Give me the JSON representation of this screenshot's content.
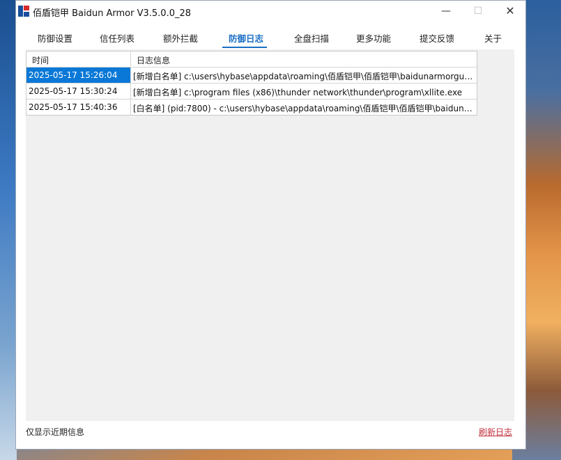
{
  "window": {
    "title": "佰盾铠甲 Baidun Armor  V3.5.0.0_28",
    "minimize": "—",
    "maximize": "☐",
    "close": "✕",
    "brand_colors": {
      "red": "#d62b2b",
      "blue": "#1a4f9e"
    }
  },
  "tabs": [
    {
      "label": "防御设置",
      "active": false
    },
    {
      "label": "信任列表",
      "active": false
    },
    {
      "label": "额外拦截",
      "active": false
    },
    {
      "label": "防御日志",
      "active": true
    },
    {
      "label": "全盘扫描",
      "active": false
    },
    {
      "label": "更多功能",
      "active": false
    },
    {
      "label": "提交反馈",
      "active": false
    },
    {
      "label": "关于",
      "active": false
    }
  ],
  "log_table": {
    "headers": {
      "time": "时间",
      "message": "日志信息"
    },
    "rows": [
      {
        "time": "2025-05-17 15:26:04",
        "message": "[新增白名单] c:\\users\\hybase\\appdata\\roaming\\佰盾铠甲\\佰盾铠甲\\baidunarmorgui...",
        "selected": true
      },
      {
        "time": "2025-05-17 15:30:24",
        "message": "[新增白名单] c:\\program files (x86)\\thunder network\\thunder\\program\\xllite.exe",
        "selected": false
      },
      {
        "time": "2025-05-17 15:40:36",
        "message": "[白名单] (pid:7800) - c:\\users\\hybase\\appdata\\roaming\\佰盾铠甲\\佰盾铠甲\\baiduna...",
        "selected": false
      }
    ]
  },
  "footer": {
    "note": "仅显示近期信息",
    "refresh": "刷新日志"
  },
  "colors": {
    "accent": "#1a6fc4",
    "selection": "#0a78d7",
    "link": "#c0303a"
  }
}
